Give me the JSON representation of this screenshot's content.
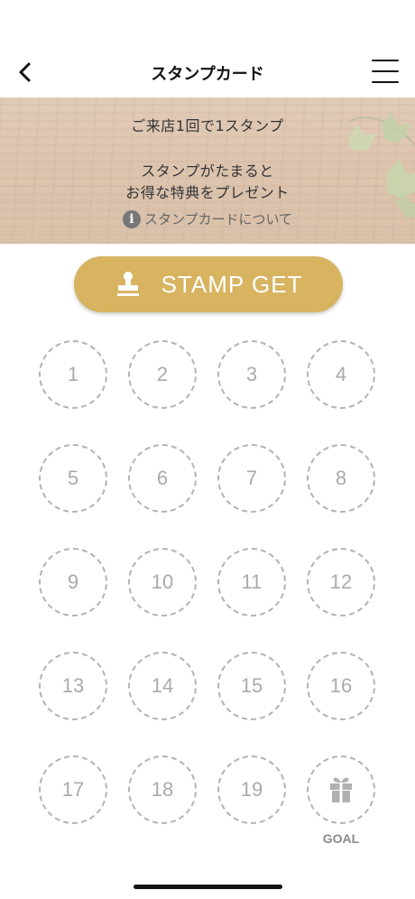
{
  "header": {
    "title": "スタンプカード",
    "back_icon": "chevron-left-icon",
    "menu_icon": "hamburger-menu-icon"
  },
  "banner": {
    "line1": "ご来店1回で1スタンプ",
    "line2": "スタンプがたまると",
    "line3": "お得な特典をプレゼント",
    "about_icon": "info-icon",
    "about_label": "スタンプカードについて"
  },
  "stamp_button": {
    "label": "STAMP GET",
    "icon": "stamp-icon",
    "color": "#d8b461"
  },
  "stamp_card": {
    "slots": [
      "1",
      "2",
      "3",
      "4",
      "5",
      "6",
      "7",
      "8",
      "9",
      "10",
      "11",
      "12",
      "13",
      "14",
      "15",
      "16",
      "17",
      "18",
      "19"
    ],
    "goal_icon": "gift-icon",
    "goal_label": "GOAL"
  }
}
